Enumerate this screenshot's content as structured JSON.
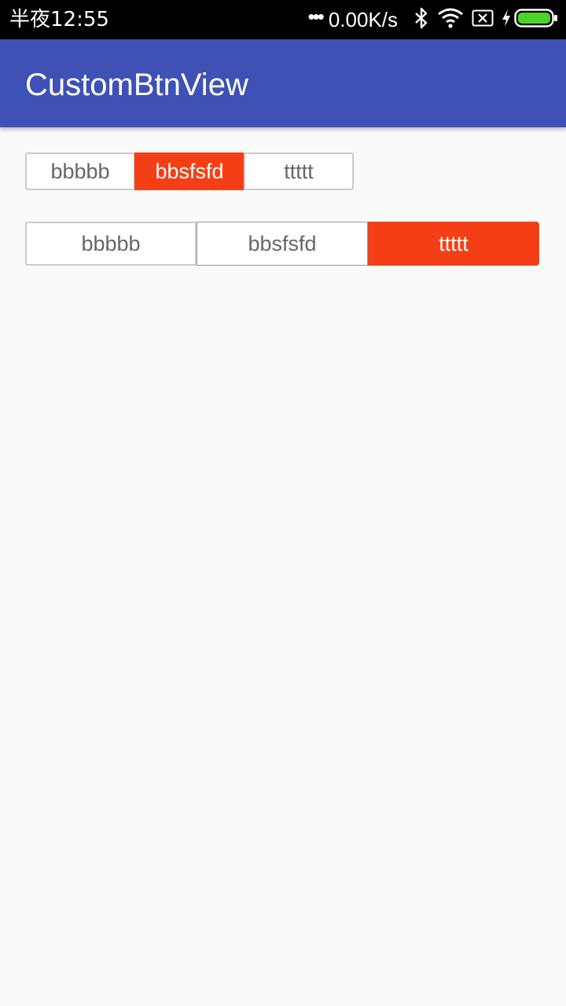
{
  "status_bar": {
    "time": "半夜12:55",
    "dots": "•••",
    "net_speed": "0.00K/s",
    "icons": [
      "bluetooth-icon",
      "wifi-icon",
      "sim-off-icon",
      "charging-icon",
      "battery-icon"
    ]
  },
  "app_bar": {
    "title": "CustomBtnView",
    "color": "#3f51b5"
  },
  "segmented_group_1": {
    "items": [
      {
        "label": "bbbbb",
        "selected": false
      },
      {
        "label": "bbsfsfd",
        "selected": true
      },
      {
        "label": "ttttt",
        "selected": false
      }
    ]
  },
  "segmented_group_2": {
    "items": [
      {
        "label": "bbbbb",
        "selected": false
      },
      {
        "label": "bbsfsfd",
        "selected": false
      },
      {
        "label": "ttttt",
        "selected": true
      }
    ]
  },
  "colors": {
    "accent": "#f43f16",
    "background": "#fafafa",
    "border": "#cccccc",
    "text": "#666666"
  }
}
